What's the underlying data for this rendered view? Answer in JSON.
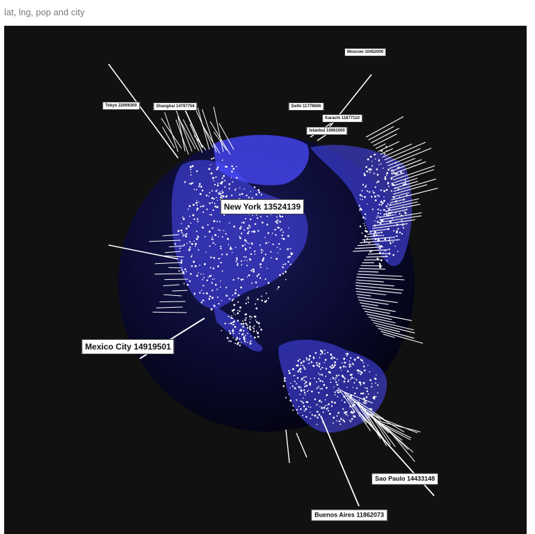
{
  "visual": {
    "title": "lat, lng, pop and city"
  },
  "colors": {
    "background": "#111111",
    "globe_base": "#0a0a2e",
    "land": "#4a4aff",
    "spikes": "#ffffff",
    "label_bg": "#ffffff"
  },
  "cities": [
    {
      "name": "Moscow",
      "population": "10452000",
      "label": "Moscow 10452000"
    },
    {
      "name": "Tokyo",
      "population": "22006300",
      "label": "Tokyo 22006300"
    },
    {
      "name": "Shanghai",
      "population": "14797756",
      "label": "Shanghai 14797756"
    },
    {
      "name": "Delhi",
      "population": "11779606",
      "label": "Delhi 11779606"
    },
    {
      "name": "Karachi",
      "population": "11877110",
      "label": "Karachi 11877110"
    },
    {
      "name": "Istanbul",
      "population": "10061000",
      "label": "Istanbul 10061000"
    },
    {
      "name": "New York",
      "population": "13524139",
      "label": "New York 13524139"
    },
    {
      "name": "Mexico City",
      "population": "14919501",
      "label": "Mexico City 14919501"
    },
    {
      "name": "Sao Paulo",
      "population": "14433148",
      "label": "Sao Paulo 14433148"
    },
    {
      "name": "Buenos Aires",
      "population": "11862073",
      "label": "Buenos Aires 11862073"
    }
  ]
}
